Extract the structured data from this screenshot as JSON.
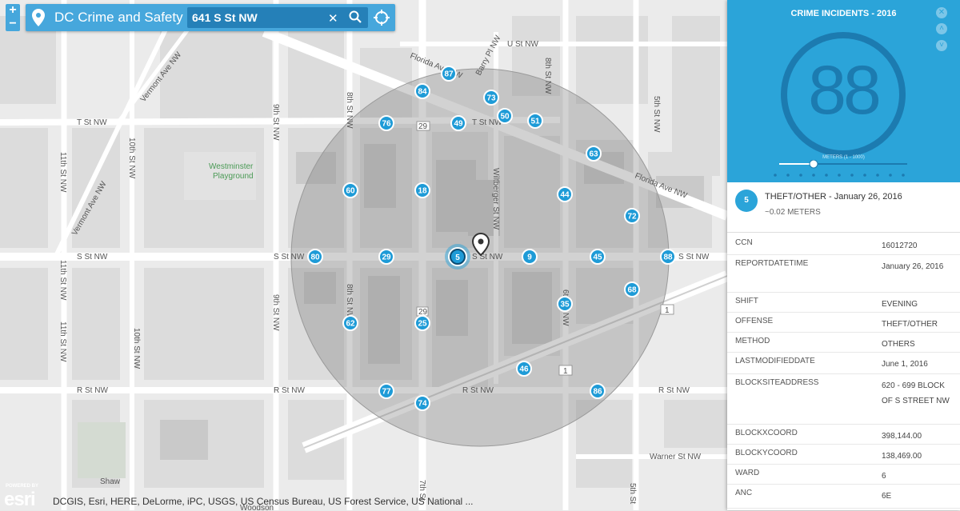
{
  "app": {
    "title": "DC Crime and Safety",
    "search_value": "641 S St NW",
    "zoom_in": "+",
    "zoom_out": "−"
  },
  "map": {
    "streets": {
      "u_st": "U St NW",
      "t_st_left": "T St NW",
      "t_st_mid": "T St NW",
      "s_st_left": "S St NW",
      "s_st_mid": "S St NW",
      "s_st_center": "S St NW",
      "s_st_right": "S St NW",
      "r_st_left": "R St NW",
      "r_st_mid": "R St NW",
      "r_st_center": "R St NW",
      "r_st_right": "R St NW",
      "florida_1": "Florida Ave NW",
      "florida_2": "Florida Ave NW",
      "vermont_1": "Vermont Ave NW",
      "vermont_2": "Vermont Ave NW",
      "barry_pl": "Barry Pl NW",
      "st_11th_a": "11th St NW",
      "st_11th_b": "11th St NW",
      "st_11th_c": "11th St NW",
      "st_10th_a": "10th St NW",
      "st_10th_b": "10th St NW",
      "st_9th_a": "9th St NW",
      "st_9th_b": "9th St NW",
      "st_8th_a": "8th St NW",
      "st_8th_b": "8th St NW",
      "st_8th_c": "8th St NW",
      "st_7th": "7th St",
      "wiltberger": "Wiltberger St NW",
      "st_6th": "6th St NW",
      "st_5th_a": "5th St NW",
      "st_5th_b": "5th St",
      "warner": "Warner St NW",
      "route_29a": "29",
      "route_29b": "29",
      "route_1a": "1",
      "route_1b": "1"
    },
    "places": {
      "westminster": [
        "Westminster",
        "Playground"
      ],
      "shaw": "Shaw",
      "woodson": "Woodson"
    },
    "buffer_color": "#7f7f7f",
    "marker_color": "#1e9bd7",
    "markers": [
      {
        "label": "87"
      },
      {
        "label": "84"
      },
      {
        "label": "73"
      },
      {
        "label": "50"
      },
      {
        "label": "51"
      },
      {
        "label": "76"
      },
      {
        "label": "49"
      },
      {
        "label": "63"
      },
      {
        "label": "60"
      },
      {
        "label": "18"
      },
      {
        "label": "44"
      },
      {
        "label": "72"
      },
      {
        "label": "80"
      },
      {
        "label": "29"
      },
      {
        "label": "9"
      },
      {
        "label": "45"
      },
      {
        "label": "88"
      },
      {
        "label": "68"
      },
      {
        "label": "35"
      },
      {
        "label": "62"
      },
      {
        "label": "25"
      },
      {
        "label": "46"
      },
      {
        "label": "77"
      },
      {
        "label": "86"
      },
      {
        "label": "74"
      }
    ],
    "selected_marker": "5",
    "attribution": "DCGIS, Esri, HERE, DeLorme, iPC, USGS, US Census Bureau, US Forest Service, US National ...",
    "esri_powered": "POWERED BY",
    "esri_brand": "esri"
  },
  "panel": {
    "title": "CRIME INCIDENTS - 2016",
    "count": "88",
    "meters_label": "METERS (1 - 1000)",
    "accent": "#2ba4d9",
    "ring_color": "#1c7bb0",
    "incident": {
      "badge": "5",
      "title": "THEFT/OTHER - January 26, 2016",
      "distance": "~0.02 METERS"
    },
    "fields": [
      {
        "key": "CCN",
        "value": "16012720"
      },
      {
        "key": "REPORTDATETIME",
        "value": "January 26, 2016"
      },
      {
        "key": "SHIFT",
        "value": "EVENING"
      },
      {
        "key": "OFFENSE",
        "value": "THEFT/OTHER"
      },
      {
        "key": "METHOD",
        "value": "OTHERS"
      },
      {
        "key": "LASTMODIFIEDDATE",
        "value": "June 1, 2016"
      },
      {
        "key": "BLOCKSITEADDRESS",
        "value": "620 - 699 BLOCK OF S STREET NW"
      },
      {
        "key": "BLOCKXCOORD",
        "value": "398,144.00"
      },
      {
        "key": "BLOCKYCOORD",
        "value": "138,469.00"
      },
      {
        "key": "WARD",
        "value": "6"
      },
      {
        "key": "ANC",
        "value": "6E"
      }
    ]
  }
}
